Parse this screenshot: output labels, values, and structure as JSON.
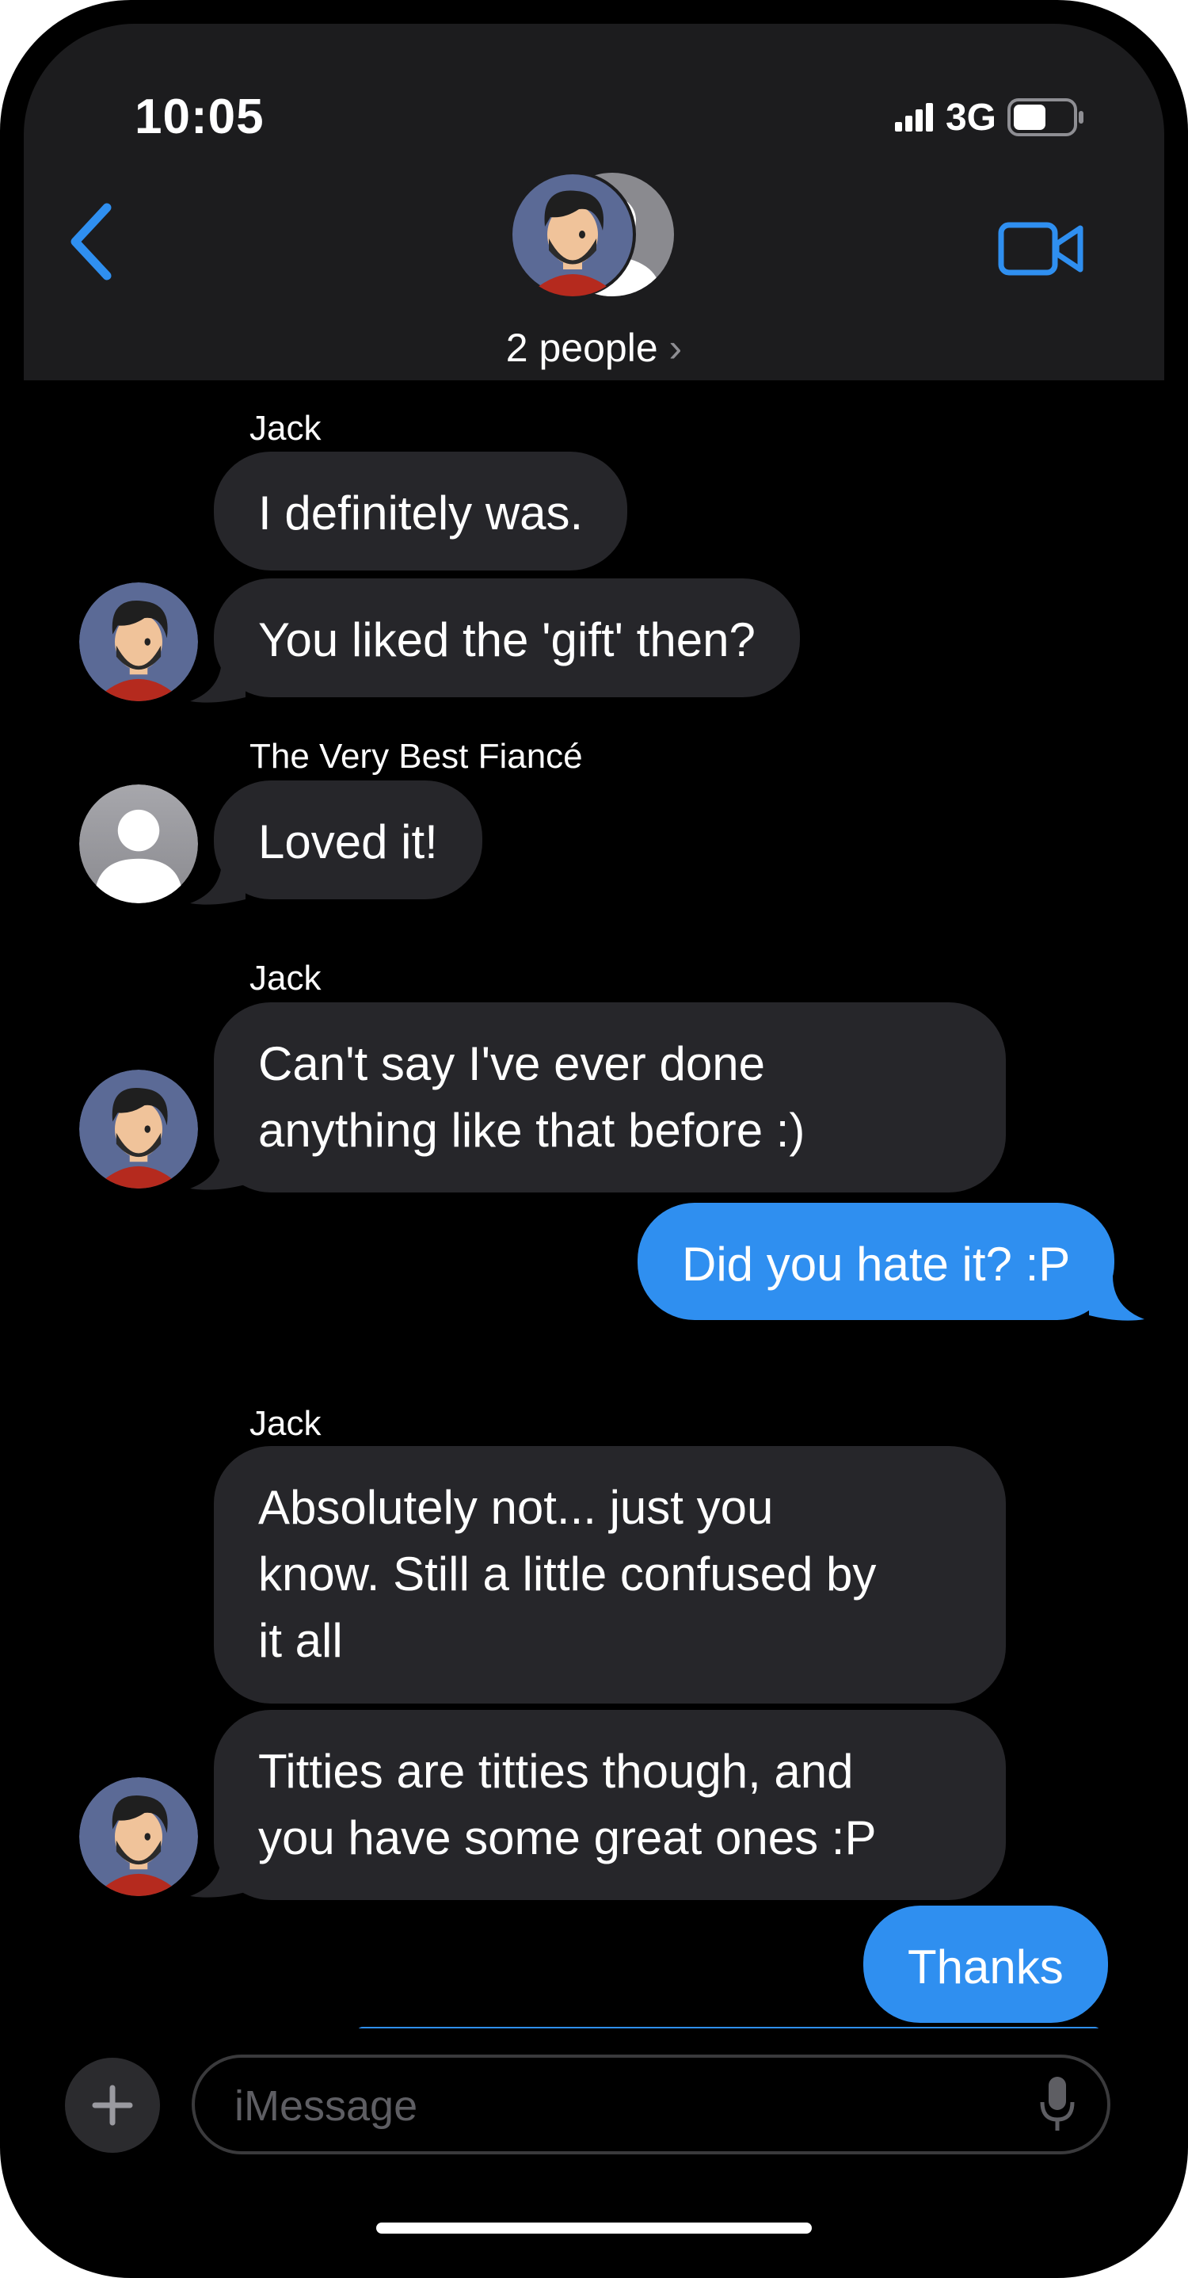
{
  "status_bar": {
    "time": "10:05",
    "network": "3G"
  },
  "header": {
    "title": "2 people",
    "title_chevron": "›",
    "back_icon": "chevron-left-icon",
    "video_icon": "video-camera-icon",
    "accent_color": "#2f8ff0"
  },
  "messages": [
    {
      "sender": "Jack",
      "text": "I definitely was.",
      "outgoing": false
    },
    {
      "sender": "Jack",
      "text": "You liked the 'gift' then?",
      "outgoing": false
    },
    {
      "sender": "The Very Best Fiancé",
      "text": "Loved it!",
      "outgoing": false
    },
    {
      "sender": "Jack",
      "lines": [
        "Can't say I've ever done",
        "anything like that before :)"
      ],
      "outgoing": false
    },
    {
      "sender": "me",
      "text": "Did you hate it? :P",
      "outgoing": true
    },
    {
      "sender": "Jack",
      "lines": [
        "Absolutely not... just you",
        "know.  Still a little confused by",
        "it all"
      ],
      "outgoing": false
    },
    {
      "sender": "Jack",
      "lines": [
        "Titties are titties though, and",
        "you have some great ones :P"
      ],
      "outgoing": false
    },
    {
      "sender": "me",
      "text": "Thanks",
      "outgoing": true
    }
  ],
  "composer": {
    "placeholder": "iMessage",
    "plus_icon": "plus-icon",
    "mic_icon": "microphone-icon"
  },
  "colors": {
    "incoming_bubble": "#26262a",
    "outgoing_bubble": "#2f8ff0",
    "header_bg": "#1c1c1e"
  }
}
